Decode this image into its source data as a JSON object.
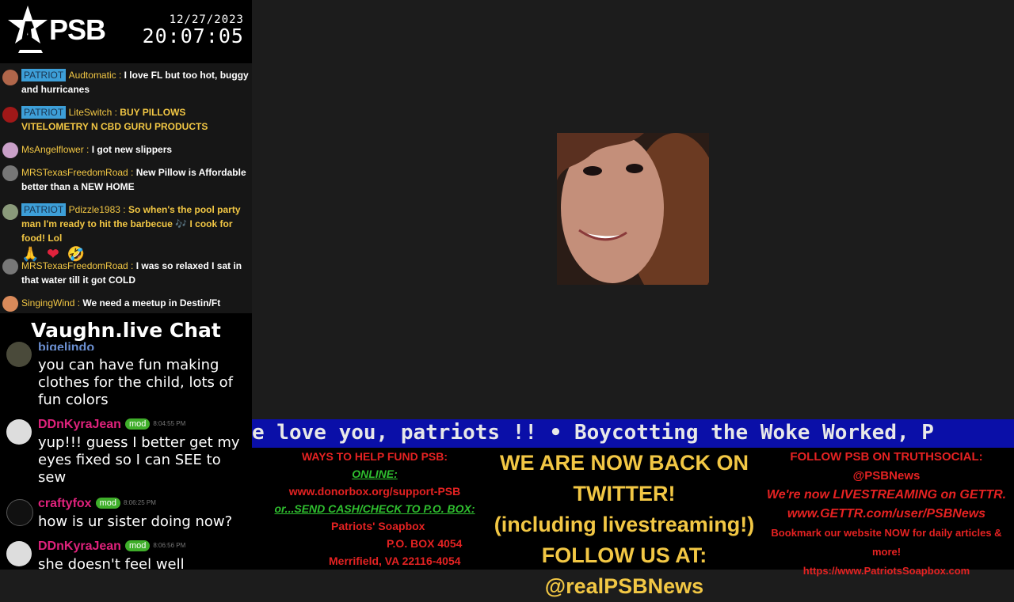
{
  "header": {
    "logo_text": "PSB",
    "date": "12/27/2023",
    "time": "20:07:05"
  },
  "chat_messages": [
    {
      "badge": "PATRIOT",
      "user": "Audtomatic",
      "text": "I love FL but too hot, buggy and hurricanes"
    },
    {
      "badge": "PATRIOT",
      "user": "LiteSwitch",
      "text": "BUY PILLOWS VITELOMETRY N CBD GURU PRODUCTS"
    },
    {
      "badge": "",
      "user": "MsAngelflower",
      "text": "I got new slippers"
    },
    {
      "badge": "",
      "user": "MRSTexasFreedomRoad",
      "text": "New Pillow is Affordable better than a NEW HOME"
    },
    {
      "badge": "PATRIOT",
      "user": "Pdizzle1983",
      "text": "So when's the pool party man I'm ready to hit the barbecue 🎶 I cook for food! Lol"
    },
    {
      "badge": "",
      "user": "MRSTexasFreedomRoad",
      "text": "I was so relaxed I sat in that water till it got COLD"
    },
    {
      "badge": "",
      "user": "SingingWind",
      "text": "We need a meetup in Destin/Ft"
    }
  ],
  "vaughn": {
    "title": "Vaughn.live Chat",
    "messages": [
      {
        "user": "bigelindo",
        "mod": "",
        "time": "",
        "text": "you can have fun making clothes for the child, lots of fun colors"
      },
      {
        "user": "DDnKyraJean",
        "mod": "mod",
        "time": "8:04:55 PM",
        "text": "yup!!! guess I better get my eyes fixed so I can SEE to sew"
      },
      {
        "user": "craftyfox",
        "mod": "mod",
        "time": "8:06:25 PM",
        "text": "how is ur sister doing now?"
      },
      {
        "user": "DDnKyraJean",
        "mod": "mod",
        "time": "8:06:56 PM",
        "text": "she doesn't feel well"
      }
    ]
  },
  "ticker": {
    "text": "e love you, patriots !!   •   Boycotting the Woke Worked, P"
  },
  "fund": {
    "title": "WAYS TO HELP FUND PSB:",
    "online_label": "ONLINE:",
    "online_url": "www.donorbox.org/support-PSB",
    "mail_label": "or...SEND CASH/CHECK TO P.O. BOX:",
    "addr1": "Patriots' Soapbox",
    "addr2": "P.O. BOX 4054",
    "addr3": "Merrifield, VA 22116-4054"
  },
  "twitter": {
    "line1": "WE ARE NOW BACK ON TWITTER!",
    "line2": "(including livestreaming!)",
    "line3": "FOLLOW US AT:",
    "line4": "@realPSBNews"
  },
  "truth": {
    "line1": "FOLLOW PSB ON TRUTHSOCIAL:",
    "line2": "@PSBNews",
    "line3": "We're now LIVESTREAMING on GETTR.",
    "line4": "www.GETTR.com/user/PSBNews",
    "line5": "Bookmark our website NOW for daily articles & more!",
    "line6": "https://www.PatriotsSoapbox.com"
  },
  "colors": {
    "patriot_badge": "#3d9fd8",
    "username_yellow": "#f2c744",
    "mod_badge": "#3fae2a",
    "ticker_bg": "#0a0fa8",
    "red_text": "#e52222"
  }
}
